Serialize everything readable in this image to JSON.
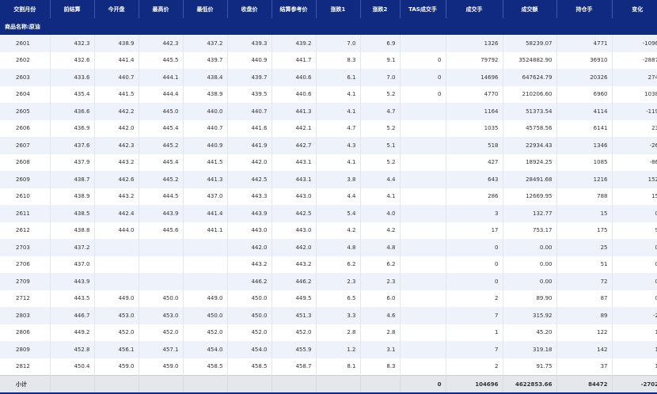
{
  "headers": [
    "交割月份",
    "前结算",
    "今开盘",
    "最高价",
    "最低价",
    "收盘价",
    "结算参考价",
    "涨跌1",
    "涨跌2",
    "TAS成交手",
    "成交手",
    "成交额",
    "持仓手",
    "变化"
  ],
  "section_label": "商品名称:原油",
  "rows": [
    [
      "2601",
      "432.3",
      "438.9",
      "442.3",
      "437.2",
      "439.3",
      "439.2",
      "7.0",
      "6.9",
      "",
      "1326",
      "58239.07",
      "4771",
      "-1096"
    ],
    [
      "2602",
      "432.6",
      "441.4",
      "445.5",
      "439.7",
      "440.9",
      "441.7",
      "8.3",
      "9.1",
      "0",
      "79792",
      "3524882.90",
      "36910",
      "-2887"
    ],
    [
      "2603",
      "433.6",
      "440.7",
      "444.1",
      "438.4",
      "439.7",
      "440.6",
      "6.1",
      "7.0",
      "0",
      "14696",
      "647624.79",
      "20326",
      "274"
    ],
    [
      "2604",
      "435.4",
      "441.5",
      "444.4",
      "438.9",
      "439.5",
      "440.6",
      "4.1",
      "5.2",
      "0",
      "4770",
      "210206.60",
      "6960",
      "1038"
    ],
    [
      "2605",
      "436.6",
      "442.2",
      "445.0",
      "440.0",
      "440.7",
      "441.3",
      "4.1",
      "4.7",
      "",
      "1164",
      "51373.54",
      "4114",
      "-119"
    ],
    [
      "2606",
      "436.9",
      "442.0",
      "445.4",
      "440.7",
      "441.6",
      "442.1",
      "4.7",
      "5.2",
      "",
      "1035",
      "45758.56",
      "6141",
      "23"
    ],
    [
      "2607",
      "437.6",
      "442.3",
      "445.2",
      "440.9",
      "441.9",
      "442.7",
      "4.3",
      "5.1",
      "",
      "518",
      "22934.43",
      "1346",
      "-26"
    ],
    [
      "2608",
      "437.9",
      "443.2",
      "445.4",
      "441.5",
      "442.0",
      "443.1",
      "4.1",
      "5.2",
      "",
      "427",
      "18924.25",
      "1085",
      "-86"
    ],
    [
      "2609",
      "438.7",
      "442.6",
      "445.2",
      "441.3",
      "442.5",
      "443.1",
      "3.8",
      "4.4",
      "",
      "643",
      "28491.68",
      "1216",
      "152"
    ],
    [
      "2610",
      "438.9",
      "443.2",
      "444.5",
      "437.0",
      "443.3",
      "443.0",
      "4.4",
      "4.1",
      "",
      "286",
      "12669.95",
      "788",
      "15"
    ],
    [
      "2611",
      "438.5",
      "442.4",
      "443.9",
      "441.4",
      "443.9",
      "442.5",
      "5.4",
      "4.0",
      "",
      "3",
      "132.77",
      "15",
      "0"
    ],
    [
      "2612",
      "438.8",
      "444.0",
      "445.6",
      "441.1",
      "443.0",
      "443.0",
      "4.2",
      "4.2",
      "",
      "17",
      "753.17",
      "175",
      "9"
    ],
    [
      "2703",
      "437.2",
      "",
      "",
      "",
      "442.0",
      "442.0",
      "4.8",
      "4.8",
      "",
      "0",
      "0.00",
      "25",
      "0"
    ],
    [
      "2706",
      "437.0",
      "",
      "",
      "",
      "443.2",
      "443.2",
      "6.2",
      "6.2",
      "",
      "0",
      "0.00",
      "51",
      "0"
    ],
    [
      "2709",
      "443.9",
      "",
      "",
      "",
      "446.2",
      "446.2",
      "2.3",
      "2.3",
      "",
      "0",
      "0.00",
      "72",
      "0"
    ],
    [
      "2712",
      "443.5",
      "449.0",
      "450.0",
      "449.0",
      "450.0",
      "449.5",
      "6.5",
      "6.0",
      "",
      "2",
      "89.90",
      "87",
      "0"
    ],
    [
      "2803",
      "446.7",
      "453.0",
      "453.0",
      "450.0",
      "450.0",
      "451.3",
      "3.3",
      "4.6",
      "",
      "7",
      "315.92",
      "89",
      "-2"
    ],
    [
      "2806",
      "449.2",
      "452.0",
      "452.0",
      "452.0",
      "452.0",
      "452.0",
      "2.8",
      "2.8",
      "",
      "1",
      "45.20",
      "122",
      "1"
    ],
    [
      "2809",
      "452.8",
      "456.1",
      "457.1",
      "454.0",
      "454.0",
      "455.9",
      "1.2",
      "3.1",
      "",
      "7",
      "319.18",
      "142",
      "1"
    ],
    [
      "2812",
      "450.4",
      "459.0",
      "459.0",
      "458.5",
      "458.5",
      "458.7",
      "8.1",
      "8.3",
      "",
      "2",
      "91.75",
      "37",
      "1"
    ]
  ],
  "footer": [
    "小计",
    "",
    "",
    "",
    "",
    "",
    "",
    "",
    "",
    "0",
    "104696",
    "4622853.66",
    "84472",
    "-2702"
  ]
}
